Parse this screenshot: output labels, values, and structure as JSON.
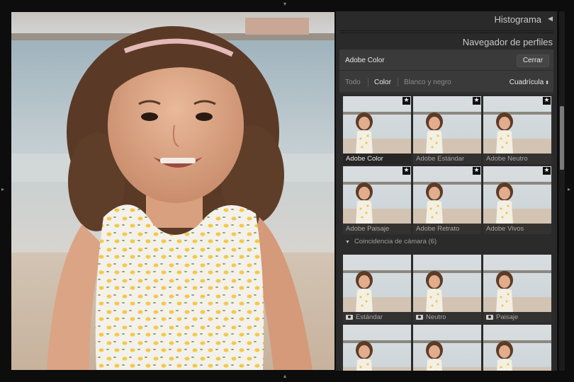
{
  "panel": {
    "histogram_title": "Histograma",
    "histogram_toggle": "◀",
    "profiles_title": "Navegador de perfiles",
    "current_profile": "Adobe Color",
    "close_label": "Cerrar"
  },
  "filters": {
    "all": "Todo",
    "color": "Color",
    "bw": "Blanco y negro",
    "active": "Color",
    "view_label": "Cuadrícula",
    "view_caret": "⬍"
  },
  "favorites": [
    {
      "label": "Adobe Color",
      "starred": true,
      "selected": true
    },
    {
      "label": "Adobe Estándar",
      "starred": true,
      "selected": false
    },
    {
      "label": "Adobe Neutro",
      "starred": true,
      "selected": false
    },
    {
      "label": "Adobe Paisaje",
      "starred": true,
      "selected": false
    },
    {
      "label": "Adobe Retrato",
      "starred": true,
      "selected": false
    },
    {
      "label": "Adobe Vivos",
      "starred": true,
      "selected": false
    }
  ],
  "group": {
    "label": "Coincidencia de cámara (6)",
    "toggle": "▼"
  },
  "camera_profiles": [
    {
      "label": "Estándar"
    },
    {
      "label": "Neutro"
    },
    {
      "label": "Paisaje"
    }
  ],
  "icons": {
    "star": "★",
    "edge_top": "⸬",
    "edge_side": "⸬"
  },
  "colors": {
    "panel_bg": "#2a2a2a",
    "subpanel_bg": "#3a3a3a",
    "text_active": "#e6e6e6",
    "text_muted": "#8c8c8c"
  }
}
